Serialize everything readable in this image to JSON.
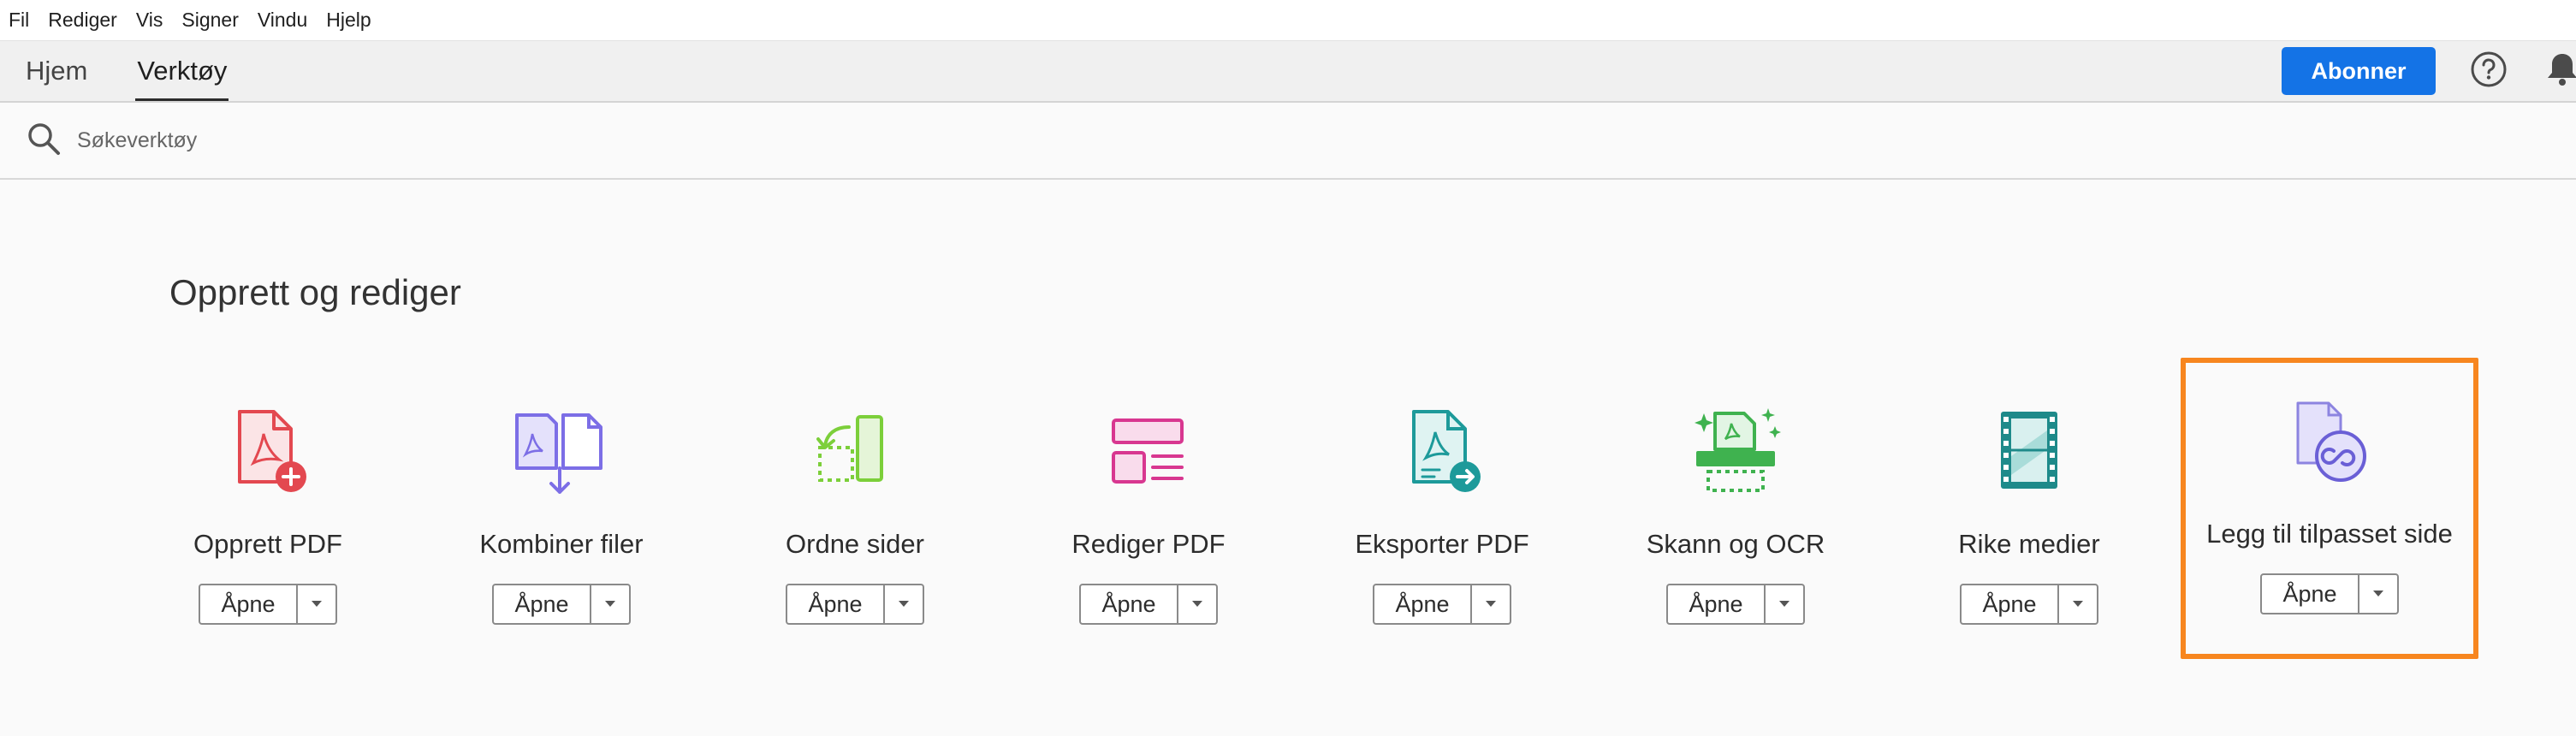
{
  "menu": [
    "Fil",
    "Rediger",
    "Vis",
    "Signer",
    "Vindu",
    "Hjelp"
  ],
  "tabs": [
    {
      "label": "Hjem",
      "active": false
    },
    {
      "label": "Verktøy",
      "active": true
    }
  ],
  "header": {
    "subscribe_label": "Abonner",
    "icons": [
      "help-icon",
      "bell-icon"
    ]
  },
  "search": {
    "placeholder": "Søkeverktøy",
    "value": ""
  },
  "section": {
    "title": "Opprett og rediger"
  },
  "tools": [
    {
      "label": "Opprett PDF",
      "icon": "create-pdf-icon",
      "open_label": "Åpne"
    },
    {
      "label": "Kombiner filer",
      "icon": "combine-files-icon",
      "open_label": "Åpne"
    },
    {
      "label": "Ordne sider",
      "icon": "organize-pages-icon",
      "open_label": "Åpne"
    },
    {
      "label": "Rediger PDF",
      "icon": "edit-pdf-icon",
      "open_label": "Åpne"
    },
    {
      "label": "Eksporter PDF",
      "icon": "export-pdf-icon",
      "open_label": "Åpne"
    },
    {
      "label": "Skann og OCR",
      "icon": "scan-ocr-icon",
      "open_label": "Åpne"
    },
    {
      "label": "Rike medier",
      "icon": "rich-media-icon",
      "open_label": "Åpne"
    },
    {
      "label": "Legg til tilpasset side",
      "icon": "add-custom-page-icon",
      "open_label": "Åpne",
      "highlighted": true
    }
  ],
  "colors": {
    "accent": "#1473e6",
    "highlight": "#f7861f",
    "create_pdf": "#e34850",
    "combine": "#7c6ee6",
    "organize": "#7ccf3a",
    "edit": "#d83790",
    "export": "#1d9a9a",
    "scan": "#3fb24f",
    "media": "#1e8a8a",
    "custom": "#6a5fd6"
  }
}
